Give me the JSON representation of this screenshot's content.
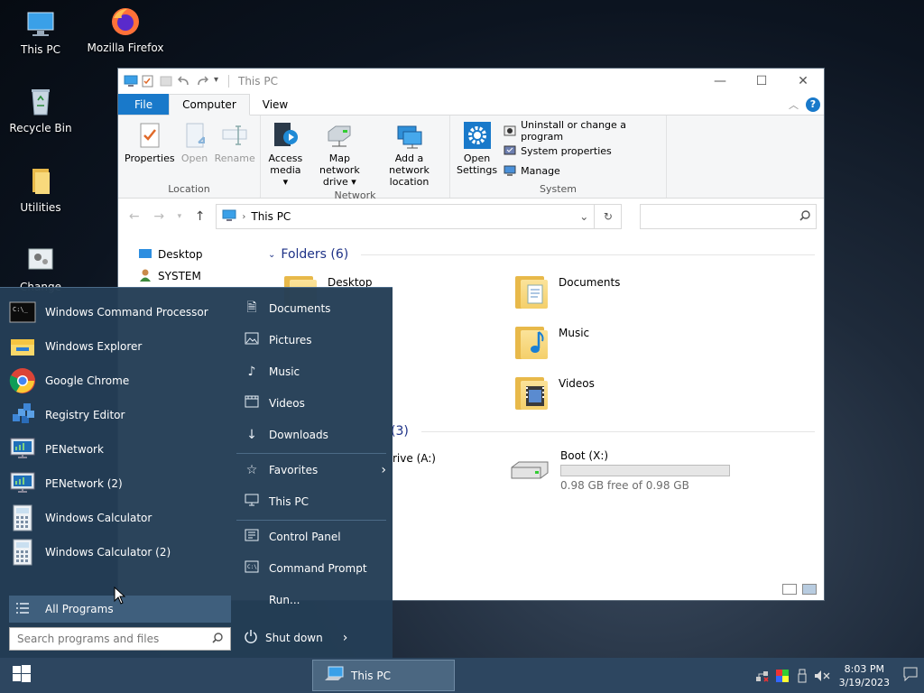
{
  "desktop": {
    "icons": [
      {
        "label": "This PC",
        "icon": "monitor-icon"
      },
      {
        "label": "Mozilla Firefox",
        "icon": "firefox-icon"
      },
      {
        "label": "Recycle Bin",
        "icon": "recycle-bin-icon"
      },
      {
        "label": "Utilities",
        "icon": "folder-icon"
      },
      {
        "label": "Change",
        "icon": "settings-applet-icon"
      }
    ]
  },
  "explorer": {
    "title": "This PC",
    "tabs": {
      "file": "File",
      "computer": "Computer",
      "view": "View"
    },
    "ribbon": {
      "location": {
        "name": "Location",
        "properties": "Properties",
        "open": "Open",
        "rename": "Rename"
      },
      "network": {
        "name": "Network",
        "access_media": [
          "Access",
          "media ▾"
        ],
        "map_drive": [
          "Map network",
          "drive ▾"
        ],
        "add_location": [
          "Add a network",
          "location"
        ]
      },
      "system": {
        "name": "System",
        "open_settings": [
          "Open",
          "Settings"
        ],
        "uninstall": "Uninstall or change a program",
        "system_properties": "System properties",
        "manage": "Manage"
      }
    },
    "address": {
      "path": "This PC",
      "search_placeholder": ""
    },
    "nav": [
      {
        "label": "Desktop"
      },
      {
        "label": "SYSTEM"
      }
    ],
    "folders_header": "Folders (6)",
    "folders": [
      {
        "name": "Desktop"
      },
      {
        "name": "Documents"
      },
      {
        "name": "Music"
      },
      {
        "name": "Videos"
      }
    ],
    "devices_header_fragment": "(3)",
    "drives": [
      {
        "name_fragment": "rive (A:)"
      },
      {
        "name": "Boot (X:)",
        "free": "0.98 GB free of 0.98 GB",
        "used_fraction": 0.0
      }
    ]
  },
  "startmenu": {
    "programs": [
      {
        "label": "Windows Command Processor",
        "icon": "cmd-icon"
      },
      {
        "label": "Windows Explorer",
        "icon": "explorer-icon"
      },
      {
        "label": "Google Chrome",
        "icon": "chrome-icon"
      },
      {
        "label": "Registry Editor",
        "icon": "registry-icon"
      },
      {
        "label": "PENetwork",
        "icon": "network-icon"
      },
      {
        "label": "PENetwork (2)",
        "icon": "network-icon"
      },
      {
        "label": "Windows Calculator",
        "icon": "calculator-icon"
      },
      {
        "label": "Windows Calculator (2)",
        "icon": "calculator-icon"
      }
    ],
    "all_programs": "All Programs",
    "search_placeholder": "Search programs and files",
    "places": [
      {
        "label": "Documents",
        "icon": "document-icon"
      },
      {
        "label": "Pictures",
        "icon": "pictures-icon"
      },
      {
        "label": "Music",
        "icon": "music-note-icon"
      },
      {
        "label": "Videos",
        "icon": "videos-icon"
      },
      {
        "label": "Downloads",
        "icon": "download-icon"
      },
      {
        "label": "Favorites",
        "icon": "star-icon"
      },
      {
        "label": "This PC",
        "icon": "monitor-icon"
      },
      {
        "label": "Control Panel",
        "icon": "control-panel-icon"
      },
      {
        "label": "Command Prompt",
        "icon": "cmd-icon"
      },
      {
        "label": "Run...",
        "icon": "run-icon"
      }
    ],
    "shutdown": "Shut down"
  },
  "taskbar": {
    "app": "This PC",
    "time": "8:03 PM",
    "date": "3/19/2023"
  },
  "colors": {
    "accent": "#1979ca",
    "startmenu_bg": "#243e56",
    "taskbar_bg": "#2d4660"
  }
}
